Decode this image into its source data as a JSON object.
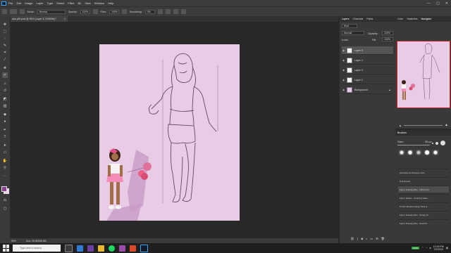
{
  "menubar": {
    "items": [
      "File",
      "Edit",
      "Image",
      "Layer",
      "Type",
      "Select",
      "Filter",
      "3D",
      "View",
      "Window",
      "Help"
    ],
    "window_controls": [
      "—",
      "▢",
      "✕"
    ]
  },
  "options_bar": {
    "mode_label": "Mode:",
    "mode_value": "Normal",
    "opacity_label": "Opacity:",
    "opacity_value": "100%",
    "flow_label": "Flow:",
    "flow_value": "100%",
    "smoothing_label": "Smoothing:",
    "smoothing_value": "0%"
  },
  "document": {
    "tab_title": "ase-y5h.psd @ 95% (Layer 3, RGB/8#) *",
    "tab_close": "×",
    "zoom": "95%",
    "doc_info": "Doc: 26.8M/56.8M"
  },
  "layers_panel": {
    "tabs": [
      "Layers",
      "Channels",
      "Paths"
    ],
    "kind_label": "Kind",
    "blend_mode": "Normal",
    "opacity_label": "Opacity:",
    "opacity_value": "100%",
    "lock_label": "Lock:",
    "fill_label": "Fill:",
    "fill_value": "100%",
    "layers": [
      {
        "name": "Layer 5",
        "selected": true
      },
      {
        "name": "Layer 4",
        "selected": false
      },
      {
        "name": "Layer 3",
        "selected": false
      },
      {
        "name": "Layer 2",
        "selected": false
      },
      {
        "name": "Background",
        "selected": false,
        "locked": true
      }
    ]
  },
  "navigator_panel": {
    "tabs": [
      "Color",
      "Swatches",
      "Navigator"
    ]
  },
  "brushes_panel": {
    "title": "Brushes",
    "size_label": "Size:",
    "size_value": "35 px",
    "brushes": [
      "Hard Round Pressure Size",
      "Soft Round",
      "Kyle's Drawing Box - HB Pencil",
      "Kyle's Inkbox - Amazing Carto...",
      "KYLE Ultimate Inking Thick &...",
      "Kyle's Drawing Box - Shady St...",
      "Kyle's Drawing Box - Real Pe..."
    ],
    "selected_index": 2
  },
  "taskbar": {
    "search_placeholder": "Type here to search",
    "battery": "100%",
    "time": "12:43 PM",
    "date": "7/2/2020"
  },
  "colors": {
    "canvas_bg": "#e8cce6",
    "foreground": "#8b3f8f",
    "background": "#f3d2ee",
    "accent": "#31a8ff"
  },
  "icons": [
    "move-icon",
    "marquee-icon",
    "lasso-icon",
    "quick-select-icon",
    "crop-icon",
    "eyedropper-icon",
    "healing-icon",
    "brush-icon",
    "stamp-icon",
    "history-brush-icon",
    "eraser-icon",
    "gradient-icon",
    "blur-icon",
    "dodge-icon",
    "pen-icon",
    "type-icon",
    "path-select-icon",
    "rectangle-icon",
    "hand-icon",
    "zoom-icon"
  ]
}
